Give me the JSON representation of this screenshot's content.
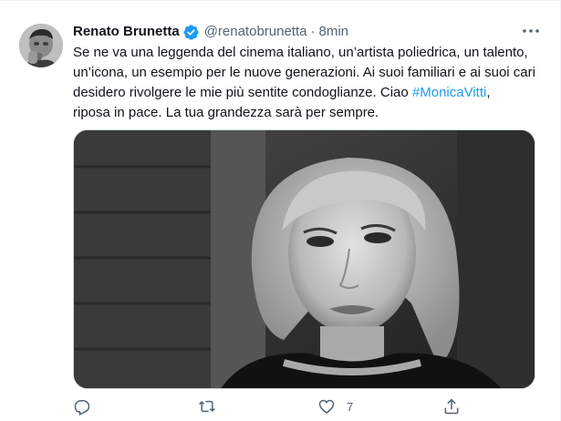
{
  "author": {
    "name": "Renato Brunetta",
    "handle": "@renatobrunetta",
    "separator": "·",
    "time": "8min"
  },
  "tweet": {
    "lines": [
      "Se ne va una leggenda del cinema italiano, un’artista poliedrica, un talento,",
      "un’icona, un esempio per le nuove generazioni. Ai suoi familiari e ai suoi cari",
      "desidero rivolgere le mie più sentite condoglianze. Ciao "
    ],
    "hashtag": "#MonicaVitti",
    "line3_suffix": ",",
    "line4": "riposa in pace. La tua grandezza sarà per sempre."
  },
  "actions": {
    "reply_count": "",
    "retweet_count": "",
    "like_count": "7"
  },
  "colors": {
    "accent": "#1d9bf0",
    "text": "#0f1419",
    "secondary": "#536471"
  },
  "icons": {
    "verified": "verified-badge-icon",
    "more": "more-dots-icon",
    "reply": "reply-icon",
    "retweet": "retweet-icon",
    "like": "heart-icon",
    "share": "share-icon"
  }
}
